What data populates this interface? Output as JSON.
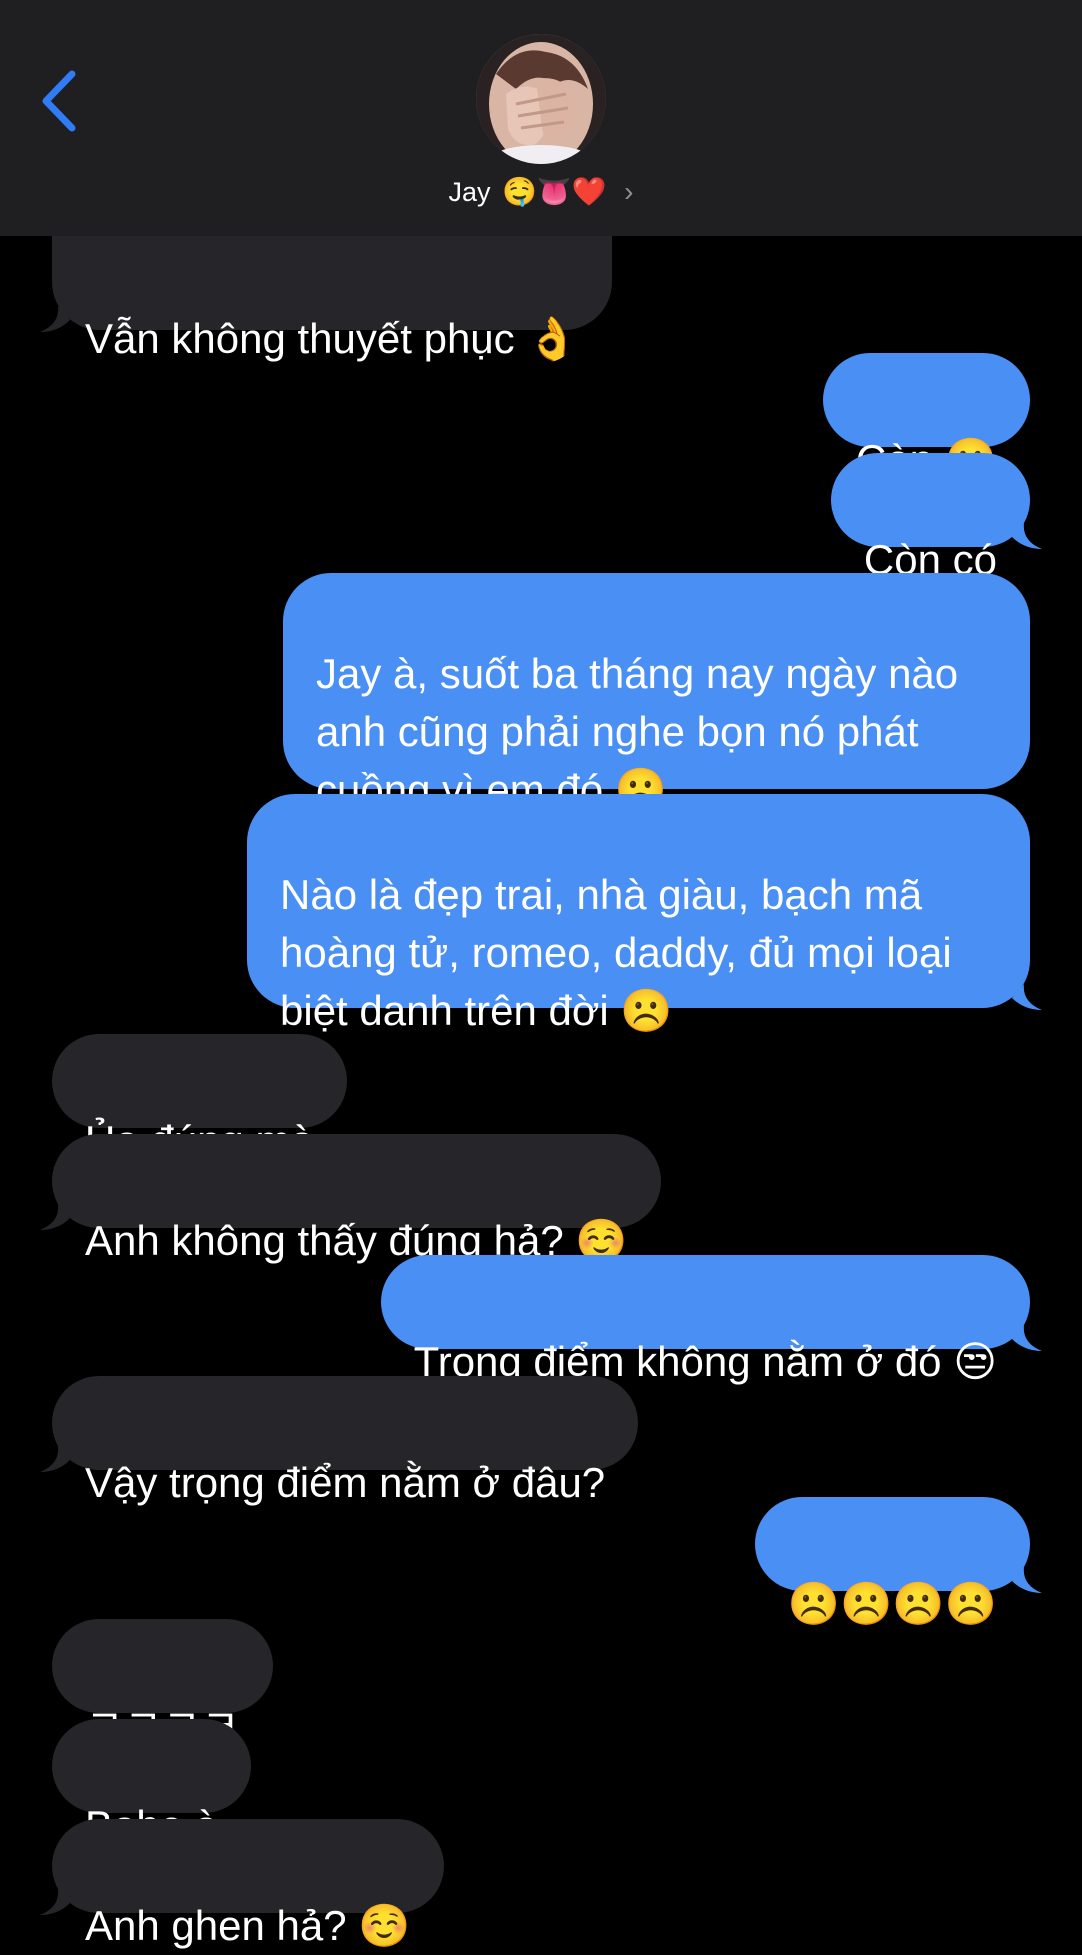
{
  "header": {
    "contact_name": "Jay",
    "contact_emojis": "🤤👅❤️",
    "back_icon": "chevron-left-icon",
    "disclosure_icon": "chevron-right-icon"
  },
  "colors": {
    "incoming_bubble": "#26252a",
    "outgoing_bubble": "#4a8ff3",
    "header_bg": "#1f1f21",
    "accent": "#2f7cf6"
  },
  "messages": [
    {
      "from": "them",
      "text": "Vẫn không thuyết phục 👌"
    },
    {
      "from": "me",
      "text": "Còn ☹️"
    },
    {
      "from": "me",
      "text": "Còn có"
    },
    {
      "from": "me",
      "text": "Jay à, suốt ba tháng nay ngày nào anh cũng phải nghe bọn nó phát cuồng vì em đó ☹️"
    },
    {
      "from": "me",
      "text": "Nào là đẹp trai, nhà giàu, bạch mã hoàng tử, romeo, daddy, đủ mọi loại biệt danh trên đời ☹️"
    },
    {
      "from": "them",
      "text": "Ủa đúng mà"
    },
    {
      "from": "them",
      "text": "Anh không thấy đúng hả? ☺️"
    },
    {
      "from": "me",
      "text": "Trọng điểm không nằm ở đó 😒"
    },
    {
      "from": "them",
      "text": "Vậy trọng điểm nằm ở đâu?"
    },
    {
      "from": "me",
      "text": "☹️☹️☹️☹️"
    },
    {
      "from": "them",
      "text": "ㅋㅋㅋㅋ"
    },
    {
      "from": "them",
      "text": "Babe à"
    },
    {
      "from": "them",
      "text": "Anh ghen hả? ☺️"
    }
  ]
}
